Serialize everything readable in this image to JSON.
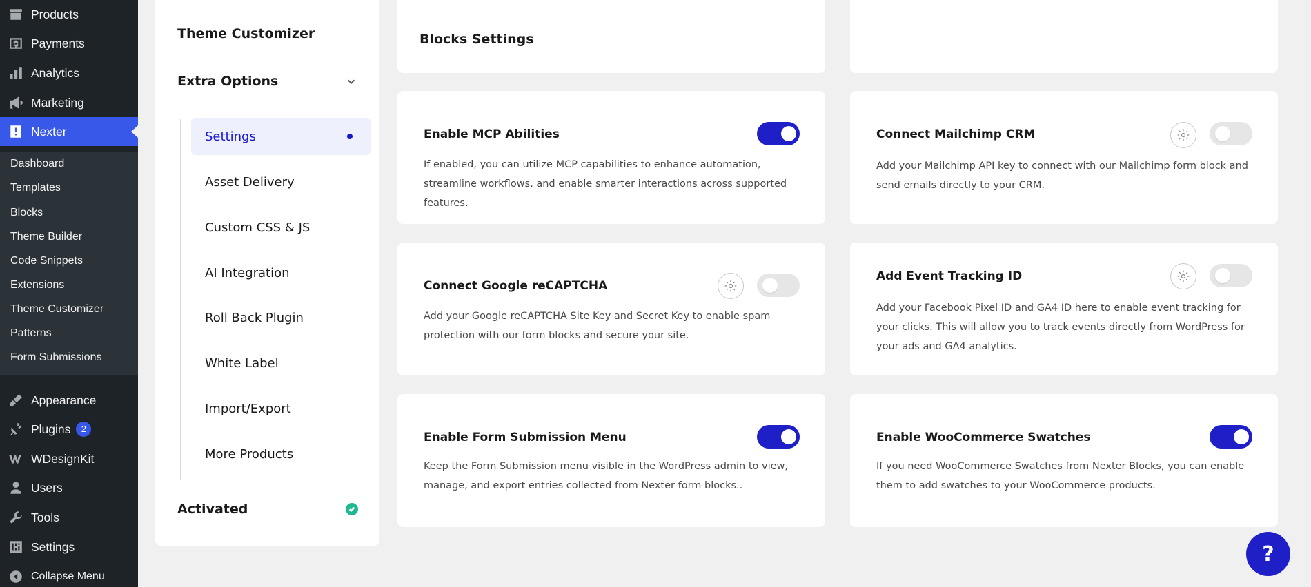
{
  "wp_menu": {
    "top_items": [
      {
        "label": "Products",
        "icon": "archive-icon"
      },
      {
        "label": "Payments",
        "icon": "dollar-icon"
      },
      {
        "label": "Analytics",
        "icon": "bar-chart-icon"
      },
      {
        "label": "Marketing",
        "icon": "megaphone-icon"
      },
      {
        "label": "Nexter",
        "icon": "exclamation-icon"
      }
    ],
    "submenu": [
      "Dashboard",
      "Templates",
      "Blocks",
      "Theme Builder",
      "Code Snippets",
      "Extensions",
      "Theme Customizer",
      "Patterns",
      "Form Submissions"
    ],
    "bottom_items": [
      {
        "label": "Appearance",
        "icon": "brush-icon"
      },
      {
        "label": "Plugins",
        "icon": "plug-icon",
        "badge": "2"
      },
      {
        "label": "WDesignKit",
        "icon": "wdesignkit-icon"
      },
      {
        "label": "Users",
        "icon": "user-icon"
      },
      {
        "label": "Tools",
        "icon": "wrench-icon"
      },
      {
        "label": "Settings",
        "icon": "sliders-icon"
      },
      {
        "label": "Collapse Menu",
        "icon": "collapse-icon"
      }
    ]
  },
  "panel": {
    "theme_customizer": "Theme Customizer",
    "extra_options": "Extra Options",
    "nav": [
      "Settings",
      "Asset Delivery",
      "Custom CSS & JS",
      "AI Integration",
      "Roll Back Plugin",
      "White Label",
      "Import/Export",
      "More Products"
    ],
    "activated": "Activated"
  },
  "blocks_settings_title": "Blocks Settings",
  "cards": [
    {
      "title": "Enable MCP Abilities",
      "desc": "If enabled, you can utilize MCP capabilities to enhance automation, streamline workflows, and enable smarter interactions across supported features.",
      "enabled": true
    },
    {
      "title": "Connect Mailchimp CRM",
      "desc": "Add your Mailchimp API key to connect with our Mailchimp form block and send emails directly to your CRM.",
      "enabled": false
    },
    {
      "title": "Connect Google reCAPTCHA",
      "desc": "Add your Google reCAPTCHA Site Key and Secret Key to enable spam protection with our form blocks and secure your site.",
      "enabled": false
    },
    {
      "title": "Add Event Tracking ID",
      "desc": "Add your Facebook Pixel ID and GA4 ID here to enable event tracking for your clicks. This will allow you to track events directly from WordPress for your ads and GA4 analytics.",
      "enabled": false
    },
    {
      "title": "Enable Form Submission Menu",
      "desc": "Keep the Form Submission menu visible in the WordPress admin to view, manage, and export entries collected from Nexter form blocks..",
      "enabled": true
    },
    {
      "title": "Enable WooCommerce Swatches",
      "desc": "If you need WooCommerce Swatches from Nexter Blocks, you can enable them to add swatches to your WooCommerce products.",
      "enabled": true
    }
  ],
  "help_label": "?",
  "colors": {
    "accent": "#1f1fc7",
    "wp_blue": "#3858e9",
    "sidebar": "#1d2327",
    "success": "#1fb890"
  }
}
